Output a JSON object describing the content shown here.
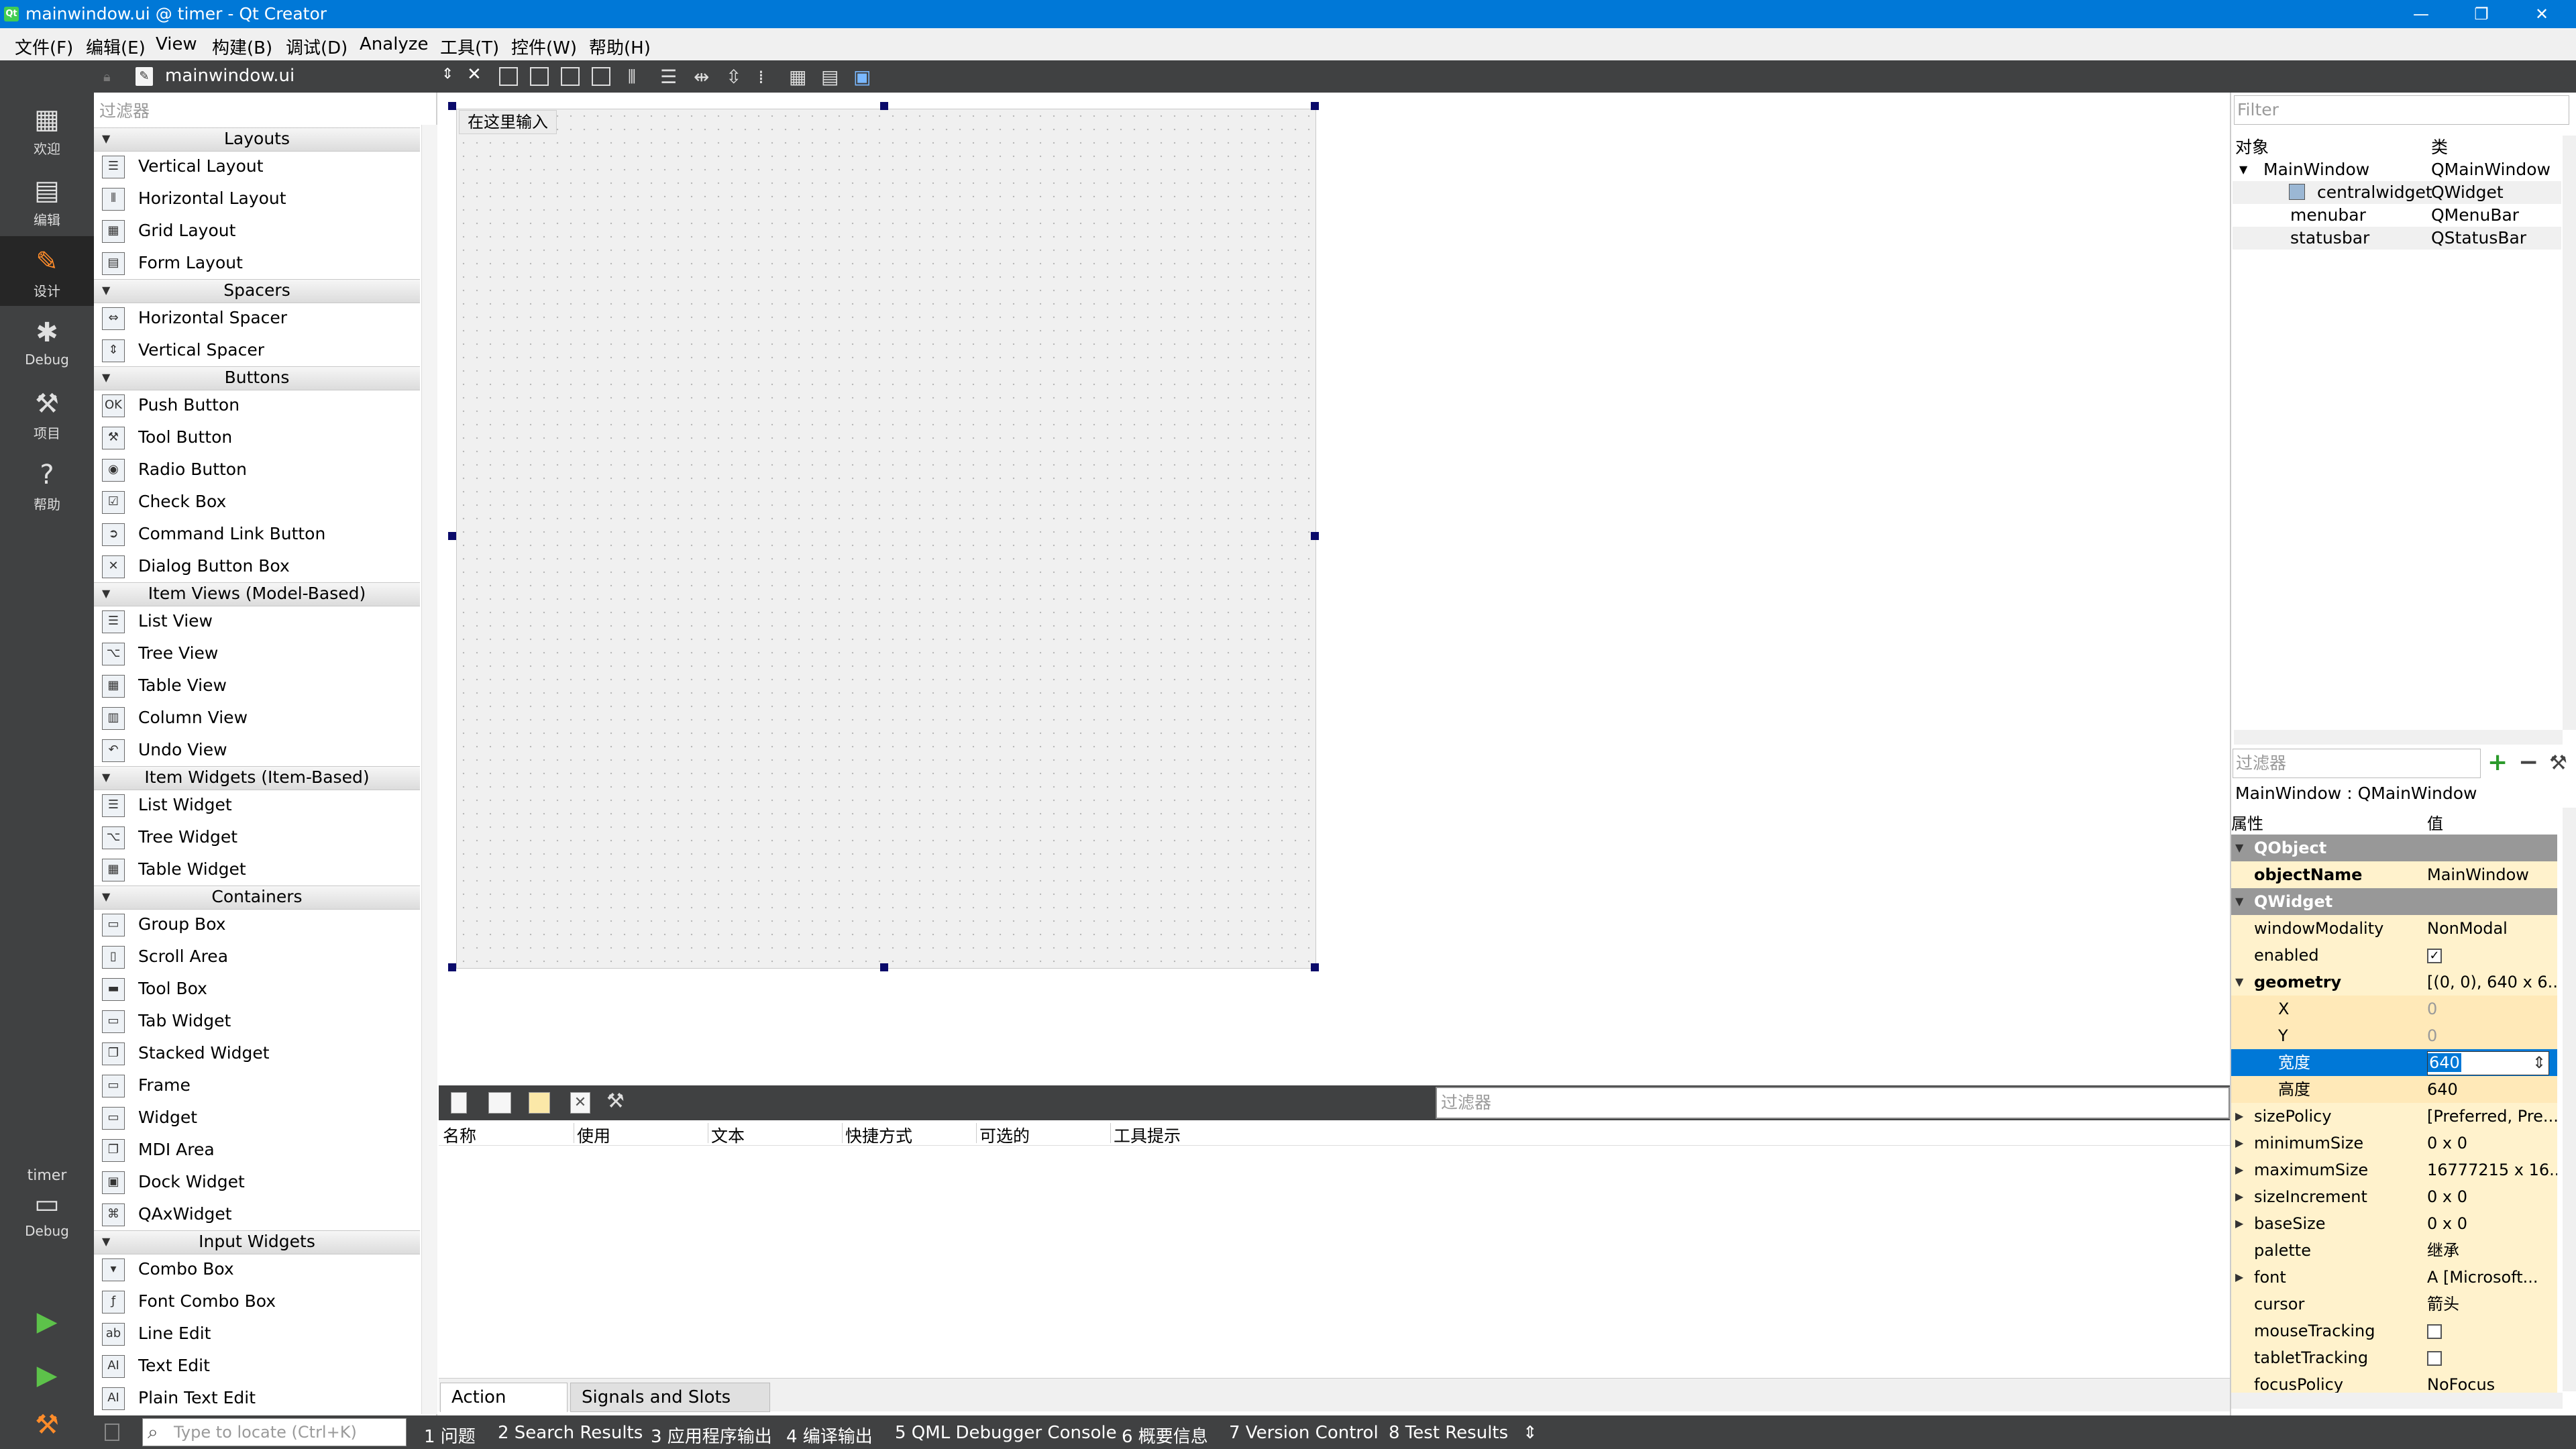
{
  "window": {
    "title": "mainwindow.ui @ timer - Qt Creator",
    "minimize": "—",
    "maximize": "❐",
    "close": "✕"
  },
  "menubar": [
    "文件(F)",
    "编辑(E)",
    "View",
    "构建(B)",
    "调试(D)",
    "Analyze",
    "工具(T)",
    "控件(W)",
    "帮助(H)"
  ],
  "modes": [
    {
      "label": "欢迎",
      "icon": "grid-icon"
    },
    {
      "label": "编辑",
      "icon": "edit-doc-icon"
    },
    {
      "label": "设计",
      "icon": "pencil-icon"
    },
    {
      "label": "Debug",
      "icon": "bug-icon"
    },
    {
      "label": "项目",
      "icon": "wrench-icon"
    },
    {
      "label": "帮助",
      "icon": "help-icon"
    }
  ],
  "target": {
    "project": "timer",
    "config": "Debug"
  },
  "editor": {
    "filename": "mainwindow.ui"
  },
  "widgetbox": {
    "filter_placeholder": "过滤器",
    "categories": [
      {
        "name": "Layouts",
        "items": [
          "Vertical Layout",
          "Horizontal Layout",
          "Grid Layout",
          "Form Layout"
        ]
      },
      {
        "name": "Spacers",
        "items": [
          "Horizontal Spacer",
          "Vertical Spacer"
        ]
      },
      {
        "name": "Buttons",
        "items": [
          "Push Button",
          "Tool Button",
          "Radio Button",
          "Check Box",
          "Command Link Button",
          "Dialog Button Box"
        ]
      },
      {
        "name": "Item Views (Model-Based)",
        "items": [
          "List View",
          "Tree View",
          "Table View",
          "Column View",
          "Undo View"
        ]
      },
      {
        "name": "Item Widgets (Item-Based)",
        "items": [
          "List Widget",
          "Tree Widget",
          "Table Widget"
        ]
      },
      {
        "name": "Containers",
        "items": [
          "Group Box",
          "Scroll Area",
          "Tool Box",
          "Tab Widget",
          "Stacked Widget",
          "Frame",
          "Widget",
          "MDI Area",
          "Dock Widget",
          "QAxWidget"
        ]
      },
      {
        "name": "Input Widgets",
        "items": [
          "Combo Box",
          "Font Combo Box",
          "Line Edit",
          "Text Edit",
          "Plain Text Edit"
        ]
      }
    ]
  },
  "form": {
    "menu_placeholder": "在这里输入"
  },
  "action_editor": {
    "filter_placeholder": "过滤器",
    "columns": [
      "名称",
      "使用",
      "文本",
      "快捷方式",
      "可选的",
      "工具提示"
    ],
    "tabs": [
      "Action Editor",
      "Signals and Slots Editor"
    ]
  },
  "object_inspector": {
    "filter_placeholder": "Filter",
    "columns": [
      "对象",
      "类"
    ],
    "rows": [
      {
        "name": "MainWindow",
        "cls": "QMainWindow"
      },
      {
        "name": "centralwidget",
        "cls": "QWidget"
      },
      {
        "name": "menubar",
        "cls": "QMenuBar"
      },
      {
        "name": "statusbar",
        "cls": "QStatusBar"
      }
    ]
  },
  "property_editor": {
    "filter_placeholder": "过滤器",
    "title": "MainWindow : QMainWindow",
    "columns": [
      "属性",
      "值"
    ],
    "rows": [
      {
        "name": "QObject",
        "value": "",
        "type": "group"
      },
      {
        "name": "objectName",
        "value": "MainWindow",
        "type": "bold"
      },
      {
        "name": "QWidget",
        "value": "",
        "type": "group"
      },
      {
        "name": "windowModality",
        "value": "NonModal",
        "type": "normal"
      },
      {
        "name": "enabled",
        "value": "✓",
        "type": "check"
      },
      {
        "name": "geometry",
        "value": "[(0, 0), 640 x 6...",
        "type": "bold"
      },
      {
        "name": "X",
        "value": "0",
        "type": "sub"
      },
      {
        "name": "Y",
        "value": "0",
        "type": "sub"
      },
      {
        "name": "宽度",
        "value": "640",
        "type": "selected"
      },
      {
        "name": "高度",
        "value": "640",
        "type": "sub"
      },
      {
        "name": "sizePolicy",
        "value": "[Preferred, Pre...",
        "type": "normal"
      },
      {
        "name": "minimumSize",
        "value": "0 x 0",
        "type": "normal"
      },
      {
        "name": "maximumSize",
        "value": "16777215 x 16...",
        "type": "normal"
      },
      {
        "name": "sizeIncrement",
        "value": "0 x 0",
        "type": "normal"
      },
      {
        "name": "baseSize",
        "value": "0 x 0",
        "type": "normal"
      },
      {
        "name": "palette",
        "value": "继承",
        "type": "normal"
      },
      {
        "name": "font",
        "value": "A  [Microsoft...",
        "type": "normal"
      },
      {
        "name": "cursor",
        "value": "箭头",
        "type": "normal"
      },
      {
        "name": "mouseTracking",
        "value": "",
        "type": "check"
      },
      {
        "name": "tabletTracking",
        "value": "",
        "type": "check"
      },
      {
        "name": "focusPolicy",
        "value": "NoFocus",
        "type": "normal"
      }
    ]
  },
  "statusbar": {
    "locator_placeholder": "Type to locate (Ctrl+K)",
    "panes": [
      "1  问题",
      "2  Search Results",
      "3  应用程序输出",
      "4  编译输出",
      "5  QML Debugger Console",
      "6  概要信息",
      "7  Version Control",
      "8  Test Results"
    ]
  }
}
